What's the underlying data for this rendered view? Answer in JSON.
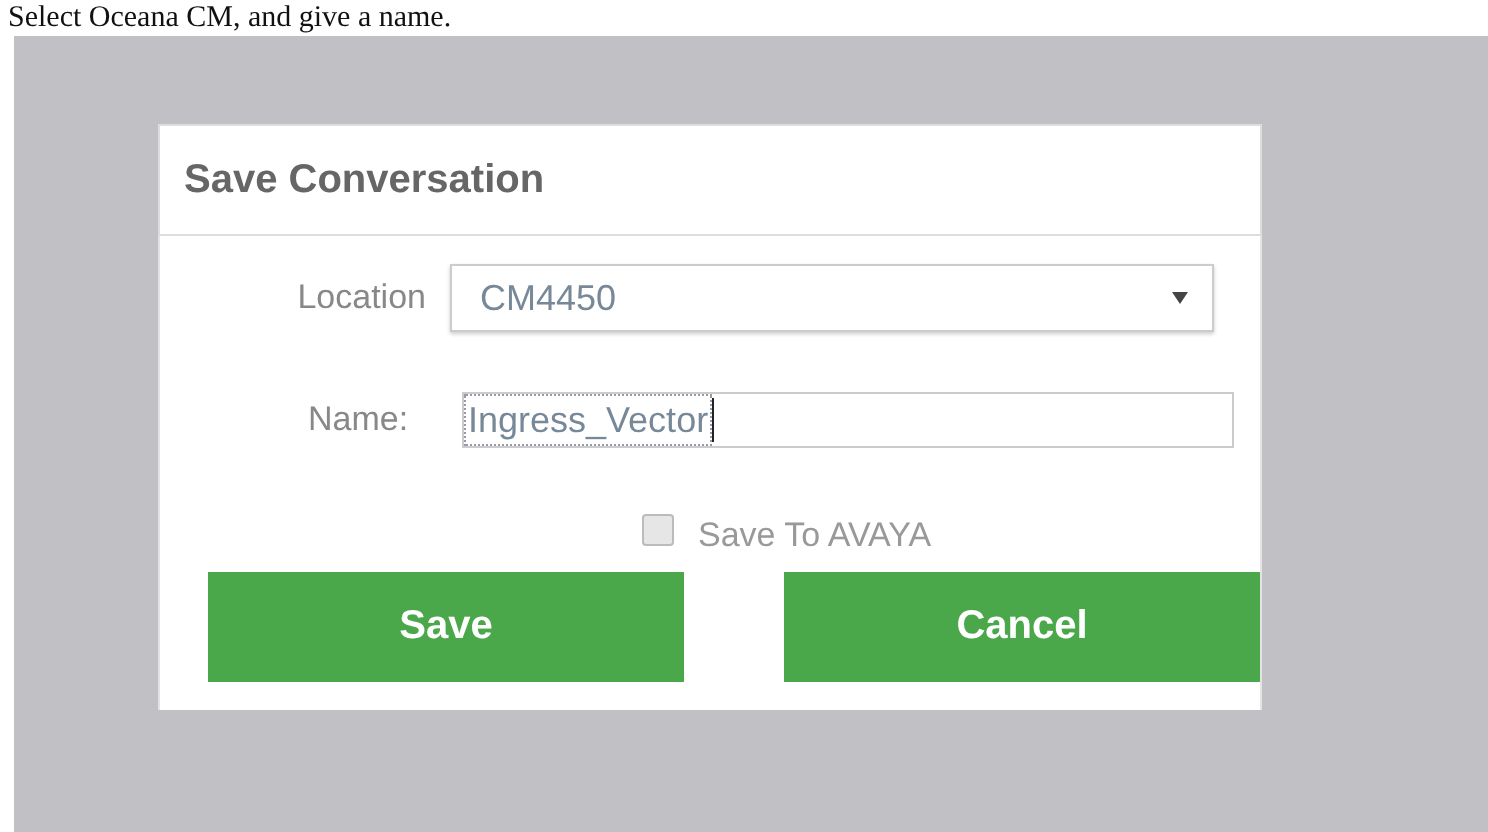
{
  "caption": "Select Oceana CM, and give a name.",
  "dialog": {
    "title": "Save Conversation",
    "location": {
      "label": "Location",
      "value": "CM4450"
    },
    "name": {
      "label": "Name:",
      "value": "Ingress_Vector"
    },
    "save_to_avaya": {
      "label": "Save To AVAYA",
      "checked": false
    },
    "buttons": [
      "Save",
      "Cancel"
    ]
  }
}
